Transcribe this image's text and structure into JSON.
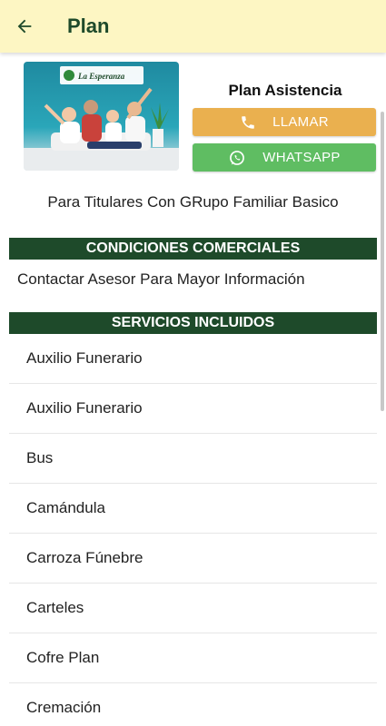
{
  "appbar": {
    "title": "Plan"
  },
  "plan": {
    "name": "Plan Asistencia",
    "call_label": "LLAMAR",
    "whatsapp_label": "WHATSAPP",
    "description": "Para Titulares Con GRupo Familiar Basico",
    "image_logo_text": "La Esperanza"
  },
  "conditions": {
    "header": "CONDICIONES COMERCIALES",
    "text": "Contactar Asesor Para Mayor Información"
  },
  "services": {
    "header": "SERVICIOS INCLUIDOS",
    "items": [
      "Auxilio Funerario",
      "Auxilio Funerario",
      "Bus",
      "Camándula",
      "Carroza Fúnebre",
      "Carteles",
      "Cofre Plan",
      "Cremación"
    ]
  },
  "colors": {
    "appbar_bg": "#fdf6c3",
    "primary_green": "#1e4a2a",
    "call_button": "#eab04f",
    "whatsapp_button": "#5fbd62"
  }
}
